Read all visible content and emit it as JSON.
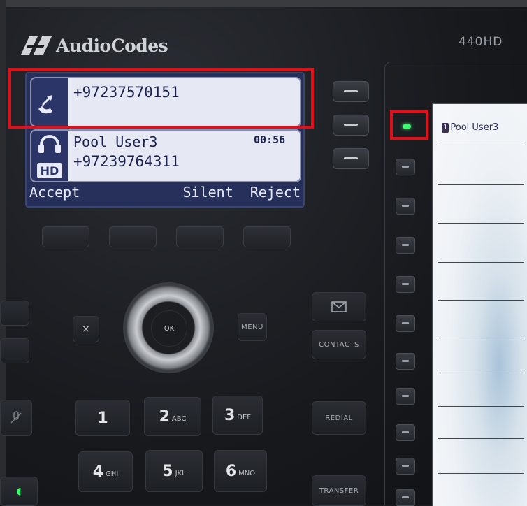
{
  "device": {
    "brand": "AudioCodes",
    "model": "440HD"
  },
  "screen": {
    "call_incoming": {
      "number": "+97237570151"
    },
    "call_active": {
      "name": "Pool User3",
      "number": "+97239764311",
      "duration": "00:56"
    },
    "softkeys": {
      "accept": "Accept",
      "silent": "Silent",
      "reject": "Reject"
    }
  },
  "nav": {
    "ok_label": "OK",
    "menu_label": "MENU",
    "cancel_label": "×"
  },
  "function_keys": {
    "contacts": "CONTACTS",
    "redial": "REDIAL",
    "transfer": "TRANSFER"
  },
  "keypad": [
    {
      "num": "1",
      "sub": ""
    },
    {
      "num": "2",
      "sub": "ABC"
    },
    {
      "num": "3",
      "sub": "DEF"
    },
    {
      "num": "4",
      "sub": "GHI"
    },
    {
      "num": "5",
      "sub": "JKL"
    },
    {
      "num": "6",
      "sub": "MNO"
    }
  ],
  "expansion": {
    "badge": "1",
    "label": "Pool User3"
  },
  "colors": {
    "highlight": "#e0101a",
    "led": "#3cff70",
    "lcd_bg": "#26305a"
  }
}
